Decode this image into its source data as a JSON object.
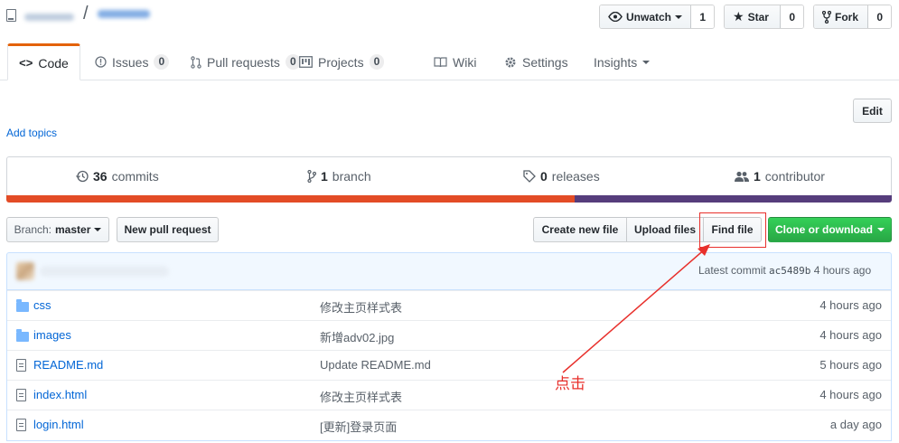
{
  "header": {
    "owner": "",
    "separator": "/",
    "repo_name": ""
  },
  "social": {
    "watch_label": "Unwatch",
    "watch_count": "1",
    "star_label": "Star",
    "star_count": "0",
    "fork_label": "Fork",
    "fork_count": "0"
  },
  "tabs": {
    "code": "Code",
    "issues": "Issues",
    "issues_count": "0",
    "pulls": "Pull requests",
    "pulls_count": "0",
    "projects": "Projects",
    "projects_count": "0",
    "wiki": "Wiki",
    "settings": "Settings",
    "insights": "Insights"
  },
  "edit_label": "Edit",
  "add_topics": "Add topics",
  "summary": {
    "commits_num": "36",
    "commits_label": "commits",
    "branch_num": "1",
    "branch_label": "branch",
    "releases_num": "0",
    "releases_label": "releases",
    "contributors_num": "1",
    "contributors_label": "contributor"
  },
  "language_bar": [
    {
      "color": "#e34c26",
      "percent": 64.2
    },
    {
      "color": "#563d7c",
      "percent": 35.8
    }
  ],
  "actions": {
    "branch_prefix": "Branch:",
    "branch_name": "master",
    "new_pr": "New pull request",
    "create_file": "Create new file",
    "upload_files": "Upload files",
    "find_file": "Find file",
    "clone": "Clone or download"
  },
  "latest_commit": {
    "author": "",
    "prefix": "Latest commit",
    "sha": "ac5489b",
    "age": "4 hours ago"
  },
  "files": [
    {
      "name": "css",
      "type": "folder",
      "message": "修改主页样式表",
      "age": "4 hours ago"
    },
    {
      "name": "images",
      "type": "folder",
      "message": "新增adv02.jpg",
      "age": "4 hours ago"
    },
    {
      "name": "README.md",
      "type": "file",
      "message": "Update README.md",
      "age": "5 hours ago"
    },
    {
      "name": "index.html",
      "type": "file",
      "message": "修改主页样式表",
      "age": "4 hours ago"
    },
    {
      "name": "login.html",
      "type": "file",
      "message": "[更新]登录页面",
      "age": "a day ago"
    }
  ],
  "annotation": {
    "label": "点击",
    "color": "#e8302c"
  },
  "colors": {
    "link": "#0366d6",
    "active_tab": "#e36209",
    "green_button": "#28a745"
  }
}
